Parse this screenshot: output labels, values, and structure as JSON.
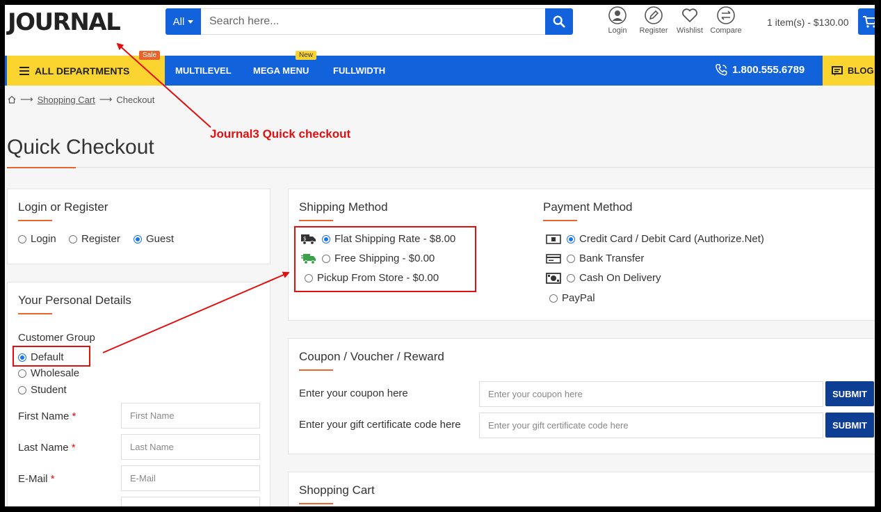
{
  "header": {
    "logo": "JOURNAL",
    "search": {
      "category": "All",
      "placeholder": "Search here..."
    },
    "icons": [
      {
        "label": "Login",
        "icon": "user-icon"
      },
      {
        "label": "Register",
        "icon": "pencil-icon"
      },
      {
        "label": "Wishlist",
        "icon": "heart-icon"
      },
      {
        "label": "Compare",
        "icon": "compare-icon"
      }
    ],
    "cart_text": "1 item(s) - $130.00"
  },
  "nav": {
    "departments": "ALL DEPARTMENTS",
    "sale_badge": "Sale",
    "new_badge": "New",
    "links": [
      "MULTILEVEL",
      "MEGA MENU",
      "FULLWIDTH"
    ],
    "phone": "1.800.555.6789",
    "blog": "BLOG"
  },
  "breadcrumb": {
    "cart": "Shopping Cart",
    "current": "Checkout"
  },
  "annotation": "Journal3 Quick checkout",
  "page_title": "Quick Checkout",
  "login_panel": {
    "title": "Login or Register",
    "options": [
      {
        "label": "Login",
        "checked": false
      },
      {
        "label": "Register",
        "checked": false
      },
      {
        "label": "Guest",
        "checked": true
      }
    ]
  },
  "personal": {
    "title": "Your Personal Details",
    "group_label": "Customer Group",
    "groups": [
      {
        "label": "Default",
        "checked": true
      },
      {
        "label": "Wholesale",
        "checked": false
      },
      {
        "label": "Student",
        "checked": false
      }
    ],
    "fields": [
      {
        "label": "First Name",
        "placeholder": "First Name"
      },
      {
        "label": "Last Name",
        "placeholder": "Last Name"
      },
      {
        "label": "E-Mail",
        "placeholder": "E-Mail"
      }
    ],
    "required_mark": "*"
  },
  "shipping": {
    "title": "Shipping Method",
    "options": [
      {
        "label": "Flat Shipping Rate - $8.00",
        "checked": true,
        "icon": "truck-icon"
      },
      {
        "label": "Free Shipping - $0.00",
        "checked": false,
        "icon": "fast-truck-icon"
      },
      {
        "label": "Pickup From Store - $0.00",
        "checked": false,
        "icon": ""
      }
    ]
  },
  "payment": {
    "title": "Payment Method",
    "options": [
      {
        "label": "Credit Card / Debit Card (Authorize.Net)",
        "checked": true,
        "icon": "card-icon"
      },
      {
        "label": "Bank Transfer",
        "checked": false,
        "icon": "bank-card-icon"
      },
      {
        "label": "Cash On Delivery",
        "checked": false,
        "icon": "cash-icon"
      },
      {
        "label": "PayPal",
        "checked": false,
        "icon": ""
      }
    ]
  },
  "coupon": {
    "title": "Coupon / Voucher / Reward",
    "coupon_label": "Enter your coupon here",
    "coupon_placeholder": "Enter your coupon here",
    "gift_label": "Enter your gift certificate code here",
    "gift_placeholder": "Enter your gift certificate code here",
    "submit": "SUBMIT"
  },
  "cart_panel": {
    "title": "Shopping Cart"
  },
  "colors": {
    "primary": "#1162db",
    "accent": "#fbd42f",
    "orange": "#e8642c",
    "annotation": "#e10f0f",
    "submit": "#0d3e93"
  }
}
